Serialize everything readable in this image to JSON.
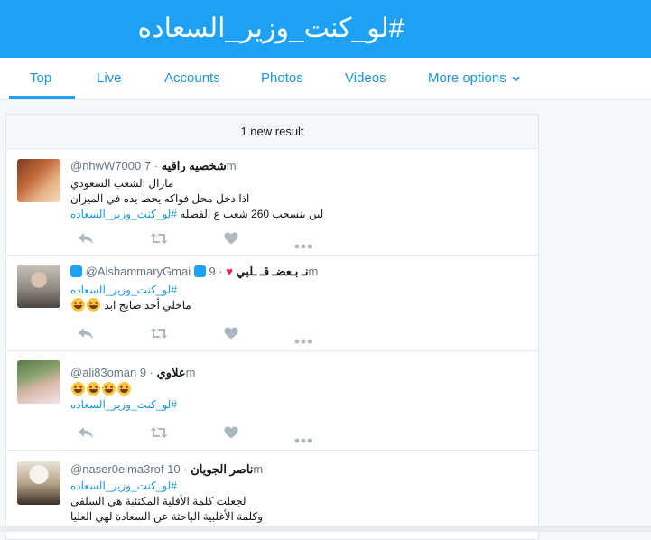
{
  "header": {
    "title": "#لو_كنت_وزير_السعاده"
  },
  "tabs": [
    {
      "label": "Top",
      "active": true
    },
    {
      "label": "Live"
    },
    {
      "label": "Accounts"
    },
    {
      "label": "Photos"
    },
    {
      "label": "Videos"
    },
    {
      "label": "More options"
    }
  ],
  "stream": {
    "new_results": "1 new result"
  },
  "tweets": [
    {
      "name": "شخصيه راقيه",
      "handle": "@nhwW7000",
      "time": "7m",
      "lines": [
        "مازال الشعب السعودي",
        "اذا دخل محل فواكه يحط يده في الميزان",
        "لين ينسحب 260 شعب ع الفصله"
      ],
      "hashtag": "#لو_كنت_وزير_السعاده",
      "emoji_count": 0
    },
    {
      "name": "نـ بـعضـ قـ ـلبي",
      "handle": "@AlshammaryGmai",
      "time": "9m",
      "hashtag": "#لو_كنت_وزير_السعاده",
      "lines": [
        "ماخلي أحد ضايج ابد"
      ],
      "emoji_count": 2
    },
    {
      "name": "علاوي",
      "handle": "@ali83oman",
      "time": "9m",
      "lines": [],
      "hashtag": "#لو_كنت_وزير_السعاده",
      "emoji_count": 4
    },
    {
      "name": "ناصر الجويان",
      "handle": "@naser0elma3rof",
      "time": "10m",
      "hashtag": "#لو_كنت_وزير_السعاده",
      "lines": [
        "لجعلت كلمة الأقلية المكتئبة هي السلفى",
        "وكلمة الأغلبية الباحثة عن السعادة لهي العليا"
      ],
      "emoji_count": 0
    }
  ],
  "icons": [
    "reply-icon",
    "retweet-icon",
    "like-icon",
    "more-icon"
  ],
  "colors": {
    "brand": "#1da1f2",
    "link": "#1b95e0",
    "heart": "#e0245e"
  }
}
